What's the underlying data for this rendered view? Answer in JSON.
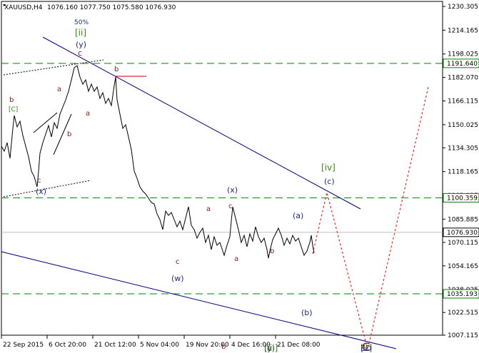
{
  "header": {
    "symbol_tf": "XAUUSD,H4",
    "ohlc": "1076.160 1077.750 1075.580 1076.930"
  },
  "colors": {
    "candle": "#000000",
    "grid": "#c0c0c0",
    "support_resistance": "#008000",
    "trend": "#000080",
    "projection": "#ff0000",
    "wave_red": "#8b1a1a",
    "wave_blue": "#1c2b8a",
    "wave_green": "#3a8a1a"
  },
  "price_axis": {
    "ticks": [
      "1230.305",
      "1214.165",
      "1198.025",
      "1182.070",
      "1166.115",
      "1150.025",
      "1134.305",
      "1118.165",
      "1102.025",
      "1085.885",
      "1070.115",
      "1054.165",
      "1038.025",
      "1022.515",
      "1007.115"
    ]
  },
  "price_levels": [
    {
      "value": 1191.64,
      "label": "1191.640",
      "style": "dashed"
    },
    {
      "value": 1100.359,
      "label": "1100.359",
      "style": "dashed"
    },
    {
      "value": 1035.193,
      "label": "1035.193",
      "style": "dashed"
    },
    {
      "value": 1076.93,
      "label": "1076.930",
      "style": "current"
    }
  ],
  "time_axis": {
    "ticks": [
      "22 Sep 2015",
      "6 Oct 20:00",
      "21 Oct 12:00",
      "5 Nov 04:00",
      "19 Nov 20:00",
      "4 Dec 16:00",
      "21 Dec 08:00"
    ]
  },
  "wave_labels": [
    {
      "text": "50%",
      "color": "blue"
    },
    {
      "text": "[ii]",
      "color": "green"
    },
    {
      "text": "(y)",
      "color": "blue"
    },
    {
      "text": "c",
      "color": "red"
    },
    {
      "text": "b",
      "color": "red"
    },
    {
      "text": "a",
      "color": "red"
    },
    {
      "text": "a",
      "color": "red"
    },
    {
      "text": "b",
      "color": "red"
    },
    {
      "text": "b",
      "color": "red"
    },
    {
      "text": "[C]",
      "color": "green"
    },
    {
      "text": "c",
      "color": "red"
    },
    {
      "text": "(x)",
      "color": "blue"
    },
    {
      "text": "(x)",
      "color": "blue"
    },
    {
      "text": "a",
      "color": "red"
    },
    {
      "text": "c",
      "color": "red"
    },
    {
      "text": "c",
      "color": "red"
    },
    {
      "text": "(w)",
      "color": "blue"
    },
    {
      "text": "b",
      "color": "red"
    },
    {
      "text": "a",
      "color": "red"
    },
    {
      "text": "b",
      "color": "red"
    },
    {
      "text": "(a)",
      "color": "blue"
    },
    {
      "text": "c",
      "color": "red"
    },
    {
      "text": "(y)",
      "color": "blue"
    },
    {
      "text": "[iii]",
      "color": "green"
    },
    {
      "text": "(b)",
      "color": "blue"
    },
    {
      "text": "[iv]",
      "color": "green"
    },
    {
      "text": "(c)",
      "color": "blue"
    },
    {
      "text": "[v]",
      "color": "green"
    },
    {
      "text": "C",
      "color": "red"
    },
    {
      "text": "ED",
      "color": "blue"
    }
  ]
}
